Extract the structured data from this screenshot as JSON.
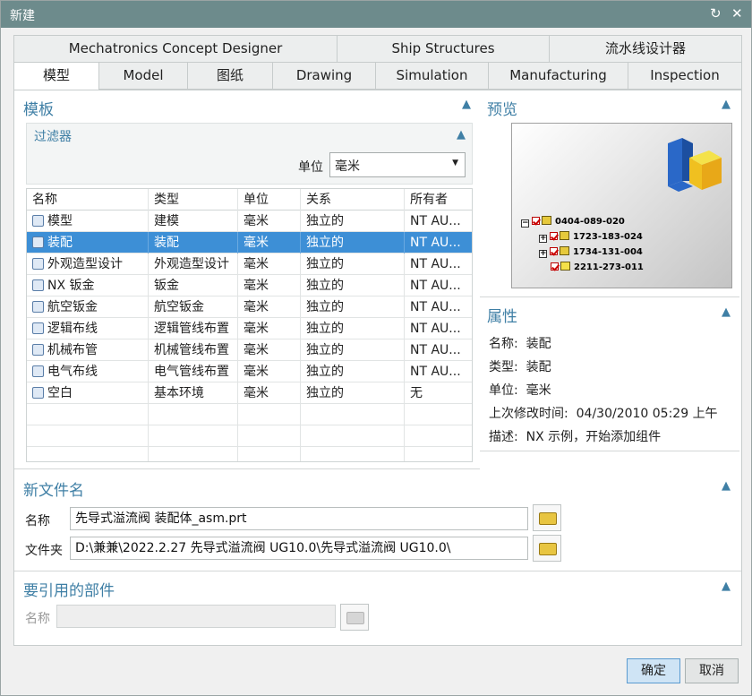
{
  "window": {
    "title": "新建"
  },
  "tabs_row1": [
    "Mechatronics Concept Designer",
    "Ship Structures",
    "流水线设计器"
  ],
  "tabs_row2": [
    "模型",
    "Model",
    "图纸",
    "Drawing",
    "Simulation",
    "Manufacturing",
    "Inspection"
  ],
  "active_tab": "模型",
  "templates": {
    "title": "模板",
    "filter": {
      "title": "过滤器",
      "unit_label": "单位",
      "unit_value": "毫米"
    },
    "columns": [
      "名称",
      "类型",
      "单位",
      "关系",
      "所有者"
    ],
    "rows": [
      {
        "name": "模型",
        "type": "建模",
        "unit": "毫米",
        "relation": "独立的",
        "owner": "NT AU..."
      },
      {
        "name": "装配",
        "type": "装配",
        "unit": "毫米",
        "relation": "独立的",
        "owner": "NT AU..."
      },
      {
        "name": "外观造型设计",
        "type": "外观造型设计",
        "unit": "毫米",
        "relation": "独立的",
        "owner": "NT AU..."
      },
      {
        "name": "NX 钣金",
        "type": "钣金",
        "unit": "毫米",
        "relation": "独立的",
        "owner": "NT AU..."
      },
      {
        "name": "航空钣金",
        "type": "航空钣金",
        "unit": "毫米",
        "relation": "独立的",
        "owner": "NT AU..."
      },
      {
        "name": "逻辑布线",
        "type": "逻辑管线布置",
        "unit": "毫米",
        "relation": "独立的",
        "owner": "NT AU..."
      },
      {
        "name": "机械布管",
        "type": "机械管线布置",
        "unit": "毫米",
        "relation": "独立的",
        "owner": "NT AU..."
      },
      {
        "name": "电气布线",
        "type": "电气管线布置",
        "unit": "毫米",
        "relation": "独立的",
        "owner": "NT AU..."
      },
      {
        "name": "空白",
        "type": "基本环境",
        "unit": "毫米",
        "relation": "独立的",
        "owner": "无"
      }
    ],
    "selected_index": 1
  },
  "preview": {
    "title": "预览",
    "tree": [
      "0404-089-020",
      "1723-183-024",
      "1734-131-004",
      "2211-273-011"
    ]
  },
  "properties": {
    "title": "属性",
    "items": [
      {
        "label": "名称:",
        "value": "装配"
      },
      {
        "label": "类型:",
        "value": "装配"
      },
      {
        "label": "单位:",
        "value": "毫米"
      },
      {
        "label": "上次修改时间:",
        "value": "04/30/2010 05:29 上午"
      },
      {
        "label": "描述:",
        "value": "NX 示例，开始添加组件"
      }
    ]
  },
  "new_file": {
    "title": "新文件名",
    "name_label": "名称",
    "name_value": "先导式溢流阀 装配体_asm.prt",
    "folder_label": "文件夹",
    "folder_value": "D:\\兼兼\\2022.2.27  先导式溢流阀 UG10.0\\先导式溢流阀  UG10.0\\"
  },
  "ref_parts": {
    "title": "要引用的部件",
    "name_label": "名称",
    "name_value": ""
  },
  "buttons": {
    "ok": "确定",
    "cancel": "取消"
  },
  "colors": {
    "titlebar": "#6d8b8c",
    "accent": "#3f7fa5",
    "selection": "#3d8fd6",
    "ok_button": "#cfe4f5"
  }
}
